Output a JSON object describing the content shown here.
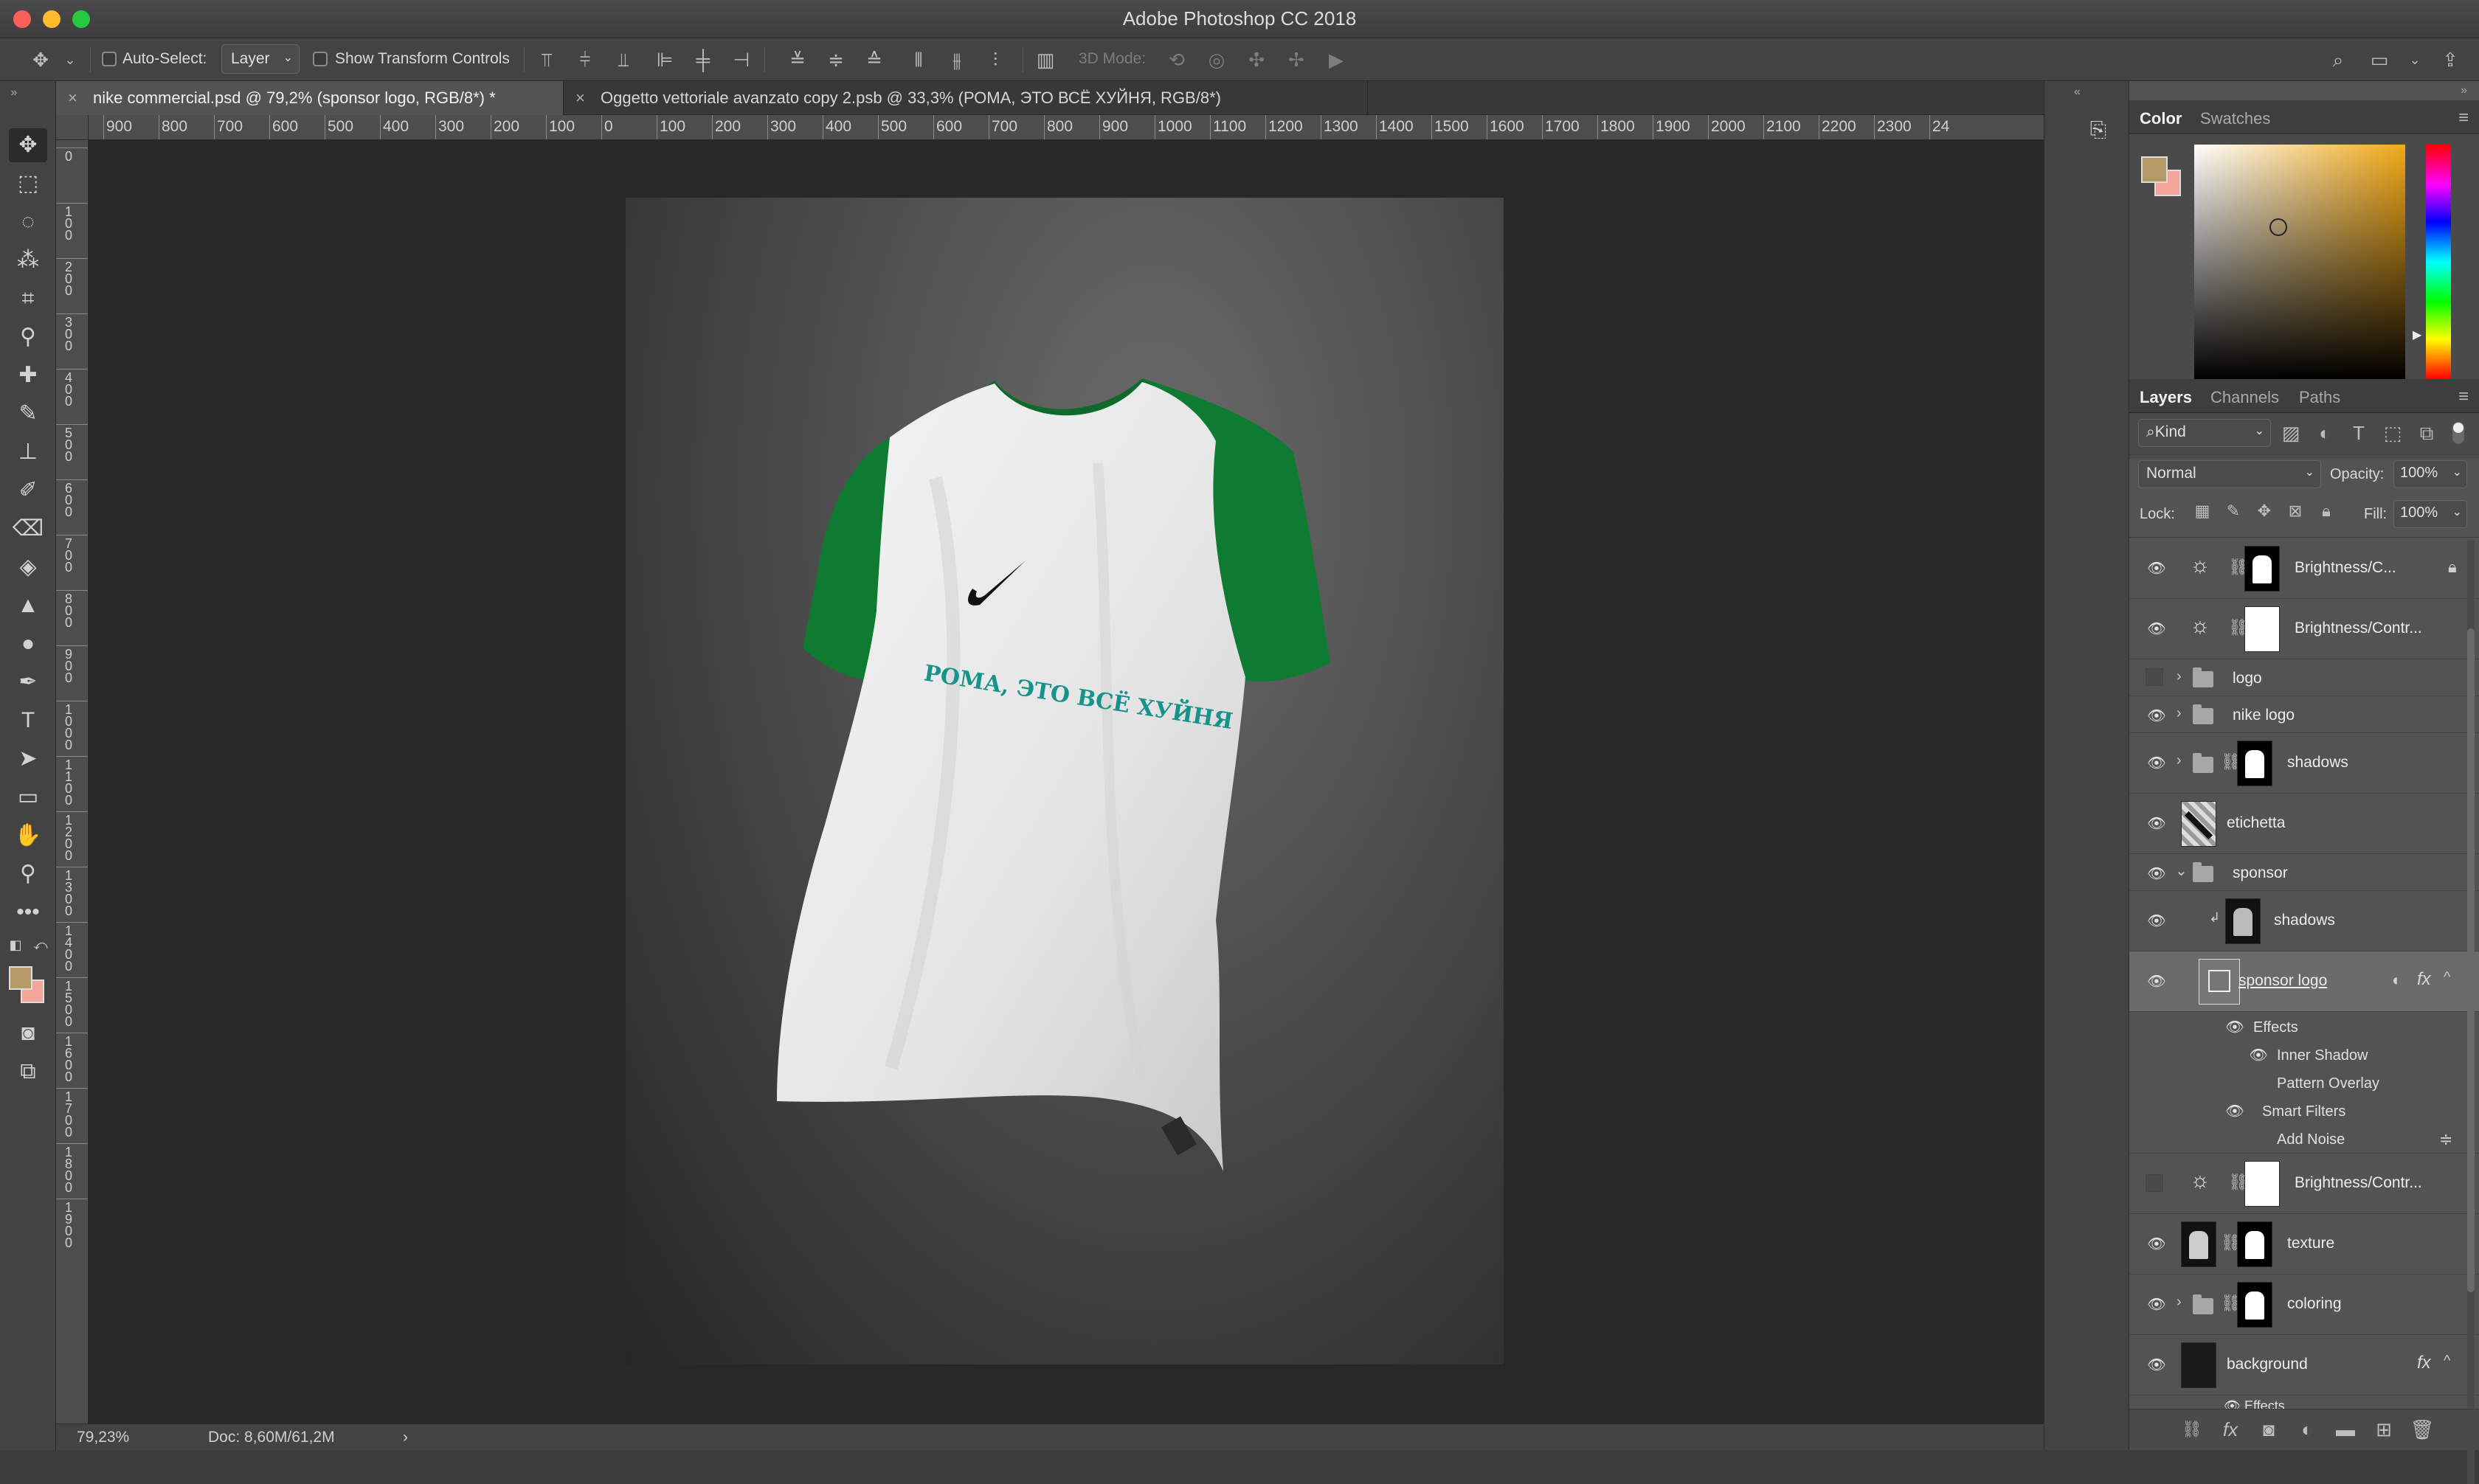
{
  "window": {
    "title": "Adobe Photoshop CC 2018"
  },
  "options_bar": {
    "auto_select_label": "Auto-Select:",
    "auto_select_value": "Layer",
    "show_transform_label": "Show Transform Controls",
    "mode_3d_label": "3D Mode:"
  },
  "tabs": [
    {
      "label": "nike commercial.psd @ 79,2% (sponsor logo, RGB/8*) *",
      "active": true
    },
    {
      "label": "Oggetto vettoriale avanzato copy 2.psb @ 33,3% (РОМА, ЭТО ВСЁ ХУЙНЯ, RGB/8*)",
      "active": false
    }
  ],
  "ruler": {
    "h_ticks": [
      "900",
      "800",
      "700",
      "600",
      "500",
      "400",
      "300",
      "200",
      "100",
      "0",
      "100",
      "200",
      "300",
      "400",
      "500",
      "600",
      "700",
      "800",
      "900",
      "1000",
      "1100",
      "1200",
      "1300",
      "1400",
      "1500",
      "1600",
      "1700",
      "1800",
      "1900",
      "2000",
      "2100",
      "2200",
      "2300",
      "24"
    ],
    "v_ticks": [
      "0",
      "100",
      "200",
      "300",
      "400",
      "500",
      "600",
      "700",
      "800",
      "900",
      "1000",
      "1100",
      "1200",
      "1300",
      "1400",
      "1500",
      "1600",
      "1700",
      "1800",
      "1900"
    ]
  },
  "canvas": {
    "shirt_text": "РОМА, ЭТО ВСЁ ХУЙНЯ",
    "colors": {
      "sleeve_green": "#0f7a32",
      "text_teal": "#17938c",
      "shirt_white": "#ececec"
    }
  },
  "status": {
    "zoom": "79,23%",
    "doc": "Doc: 8,60M/61,2M"
  },
  "color_panel": {
    "tabs": [
      "Color",
      "Swatches"
    ],
    "foreground": "#b59a67",
    "background": "#f3a59a"
  },
  "layers_panel": {
    "tabs": [
      "Layers",
      "Channels",
      "Paths"
    ],
    "filter_label": "Kind",
    "blend_mode": "Normal",
    "opacity_label": "Opacity:",
    "opacity_value": "100%",
    "lock_label": "Lock:",
    "fill_label": "Fill:",
    "fill_value": "100%",
    "layers": [
      {
        "name": "Brightness/C...",
        "type": "adjustment",
        "visible": true,
        "locked": true
      },
      {
        "name": "Brightness/Contr...",
        "type": "adjustment",
        "visible": true
      },
      {
        "name": "logo",
        "type": "group",
        "visible": false
      },
      {
        "name": "nike logo",
        "type": "group",
        "visible": true
      },
      {
        "name": "shadows",
        "type": "group-masked",
        "visible": true
      },
      {
        "name": "etichetta",
        "type": "layer",
        "visible": true
      },
      {
        "name": "sponsor",
        "type": "group-open",
        "visible": true
      },
      {
        "name": "shadows",
        "type": "clipped",
        "visible": true
      },
      {
        "name": "sponsor logo",
        "type": "smart",
        "visible": true,
        "selected": true
      },
      {
        "name": "Effects",
        "type": "sub"
      },
      {
        "name": "Inner Shadow",
        "type": "sub"
      },
      {
        "name": "Pattern Overlay",
        "type": "sub"
      },
      {
        "name": "Smart Filters",
        "type": "sub"
      },
      {
        "name": "Add Noise",
        "type": "sub"
      },
      {
        "name": "Brightness/Contr...",
        "type": "adjustment",
        "visible": false
      },
      {
        "name": "texture",
        "type": "masked",
        "visible": true
      },
      {
        "name": "coloring",
        "type": "group-masked",
        "visible": true
      },
      {
        "name": "background",
        "type": "layer-fx",
        "visible": true
      },
      {
        "name": "Effects",
        "type": "sub-cut"
      }
    ]
  }
}
